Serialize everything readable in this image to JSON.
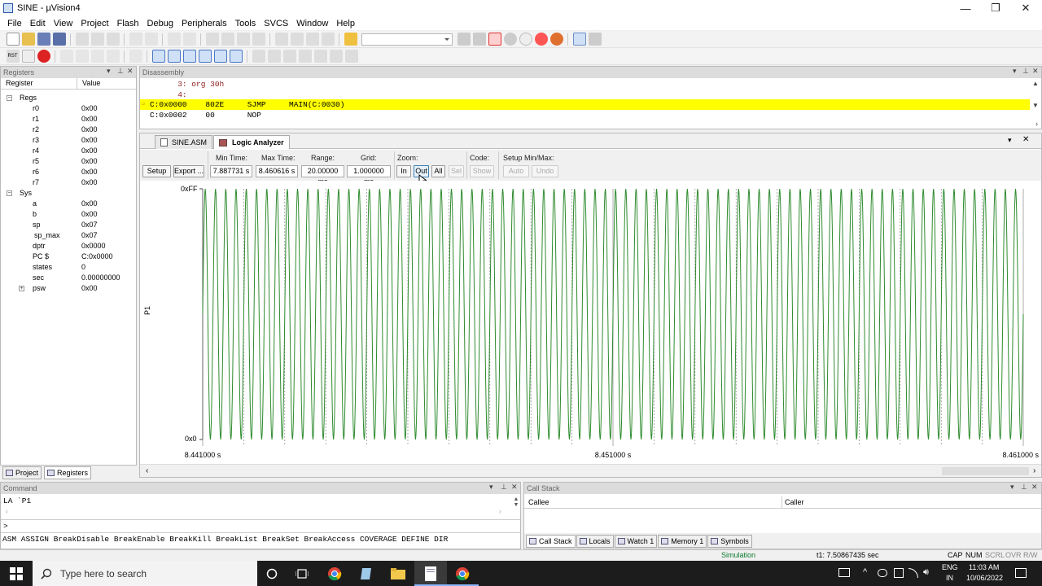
{
  "window": {
    "title": "SINE  - µVision4",
    "minimize": "—",
    "maximize": "❐",
    "close": "✕"
  },
  "menu": [
    "File",
    "Edit",
    "View",
    "Project",
    "Flash",
    "Debug",
    "Peripherals",
    "Tools",
    "SVCS",
    "Window",
    "Help"
  ],
  "registers": {
    "panel_title": "Registers",
    "col_register": "Register",
    "col_value": "Value",
    "groups": [
      {
        "name": "Regs",
        "items": [
          {
            "name": "r0",
            "value": "0x00"
          },
          {
            "name": "r1",
            "value": "0x00"
          },
          {
            "name": "r2",
            "value": "0x00"
          },
          {
            "name": "r3",
            "value": "0x00"
          },
          {
            "name": "r4",
            "value": "0x00"
          },
          {
            "name": "r5",
            "value": "0x00"
          },
          {
            "name": "r6",
            "value": "0x00"
          },
          {
            "name": "r7",
            "value": "0x00"
          }
        ]
      },
      {
        "name": "Sys",
        "items": [
          {
            "name": "a",
            "value": "0x00"
          },
          {
            "name": "b",
            "value": "0x00"
          },
          {
            "name": "sp",
            "value": "0x07"
          },
          {
            "name": "sp_max",
            "value": "0x07"
          },
          {
            "name": "dptr",
            "value": "0x0000"
          },
          {
            "name": "PC  $",
            "value": "C:0x0000"
          },
          {
            "name": "states",
            "value": "0"
          },
          {
            "name": "sec",
            "value": "0.00000000"
          },
          {
            "name": "psw",
            "value": "0x00"
          }
        ]
      }
    ],
    "tabs": [
      "Project",
      "Registers"
    ]
  },
  "disassembly": {
    "title": "Disassembly",
    "lines": [
      {
        "text": "      3: org 30h",
        "highlight": false,
        "color": "#8b1a1a"
      },
      {
        "text": "      4:",
        "highlight": false,
        "color": "#8b1a1a"
      },
      {
        "text": "C:0x0000    802E     SJMP     MAIN(C:0030)",
        "highlight": true,
        "color": "#000000"
      },
      {
        "text": "C:0x0002    00       NOP",
        "highlight": false,
        "color": "#000000"
      }
    ]
  },
  "doc_tabs": [
    "SINE.ASM",
    "Logic Analyzer"
  ],
  "logic_analyzer": {
    "setup_btn": "Setup ...",
    "export_btn": "Export ...",
    "min_time_label": "Min Time:",
    "min_time": "7.887731 s",
    "max_time_label": "Max Time:",
    "max_time": "8.460616 s",
    "range_label": "Range:",
    "range": "20.00000 ms",
    "grid_label": "Grid:",
    "grid": "1.000000 ms",
    "zoom_label": "Zoom:",
    "zoom_in": "In",
    "zoom_out": "Out",
    "zoom_all": "All",
    "zoom_sel": "Sel",
    "code_label": "Code:",
    "code_show": "Show",
    "setup_minmax_label": "Setup Min/Max:",
    "auto": "Auto",
    "undo": "Undo"
  },
  "chart_data": {
    "type": "line",
    "signal": "P1",
    "y_max_label": "0xFF",
    "y_min_label": "0x0",
    "ylim": [
      0,
      255
    ],
    "x_ticks": [
      "8.441000 s",
      "8.451000 s",
      "8.461000 s"
    ],
    "xlim": [
      8.441,
      8.461
    ],
    "cycles": 80,
    "color": "#2e8b2e",
    "grid": true
  },
  "command": {
    "title": "Command",
    "output": "LA `P1",
    "prompt": ">",
    "keywords": "ASM ASSIGN BreakDisable BreakEnable BreakKill BreakList BreakSet BreakAccess COVERAGE DEFINE DIR"
  },
  "callstack": {
    "title": "Call Stack",
    "col_callee": "Callee",
    "col_caller": "Caller",
    "tabs": [
      "Call Stack",
      "Locals",
      "Watch 1",
      "Memory 1",
      "Symbols"
    ]
  },
  "status": {
    "mode": "Simulation",
    "time": "t1: 7.50867435 sec",
    "caps": "CAP",
    "num": "NUM",
    "scrl": "SCRL",
    "ovr": "OVR",
    "rw": "R/W"
  },
  "taskbar": {
    "search_placeholder": "Type here to search",
    "lang1": "ENG",
    "lang2": "IN",
    "time": "11:03 AM",
    "date": "10/06/2022"
  },
  "accent_colors": {
    "highlight": "#ffff00",
    "signal": "#2e8b2e",
    "taskbar": "#1c1c1c"
  }
}
